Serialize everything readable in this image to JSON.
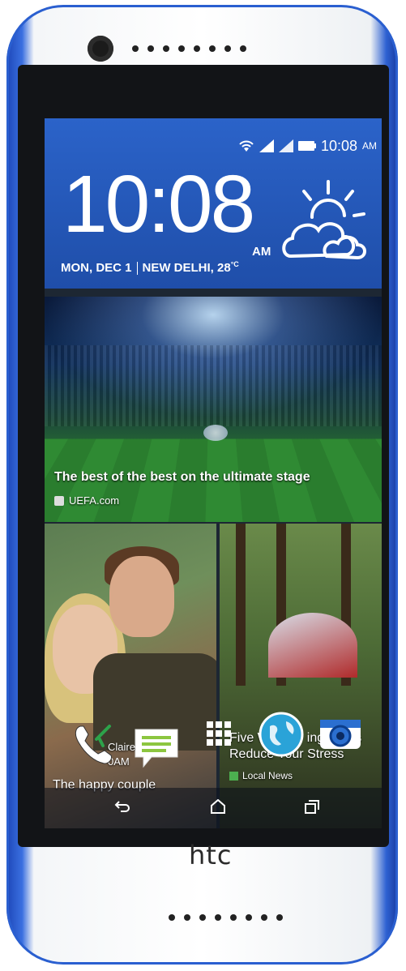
{
  "status_bar": {
    "time": "10:08",
    "ampm": "AM"
  },
  "clock_widget": {
    "time": "10:08",
    "ampm": "AM",
    "day_date": "MON, DEC ",
    "day_num": "1",
    "location": "NEW DELHI, ",
    "temp": "28",
    "temp_unit": "°C"
  },
  "feed": {
    "headline": "The best of the best on the ultimate stage",
    "source": "UEFA.com"
  },
  "tile_left": {
    "contact": "Claire",
    "time_fragment": "0AM",
    "caption": "The happy couple"
  },
  "tile_right": {
    "title_line1": "Five W",
    "title_line1_end": "ing",
    "title_line1_tail": "s",
    "title_line2": "Reduce Your Stress",
    "source": "Local News"
  },
  "brand": {
    "logo": "htc"
  },
  "icons": [
    "camera-lens",
    "wifi-icon",
    "signal-icon",
    "battery-icon",
    "weather-partly-cloudy-icon",
    "phone-icon",
    "messages-icon",
    "apps-grid-icon",
    "browser-globe-icon",
    "camera-app-icon",
    "back-icon",
    "home-icon",
    "recent-apps-icon"
  ],
  "colors": {
    "body_blue": "#2a5fd0",
    "widget_blue": "#2b63c9",
    "body_white": "#ffffff"
  }
}
